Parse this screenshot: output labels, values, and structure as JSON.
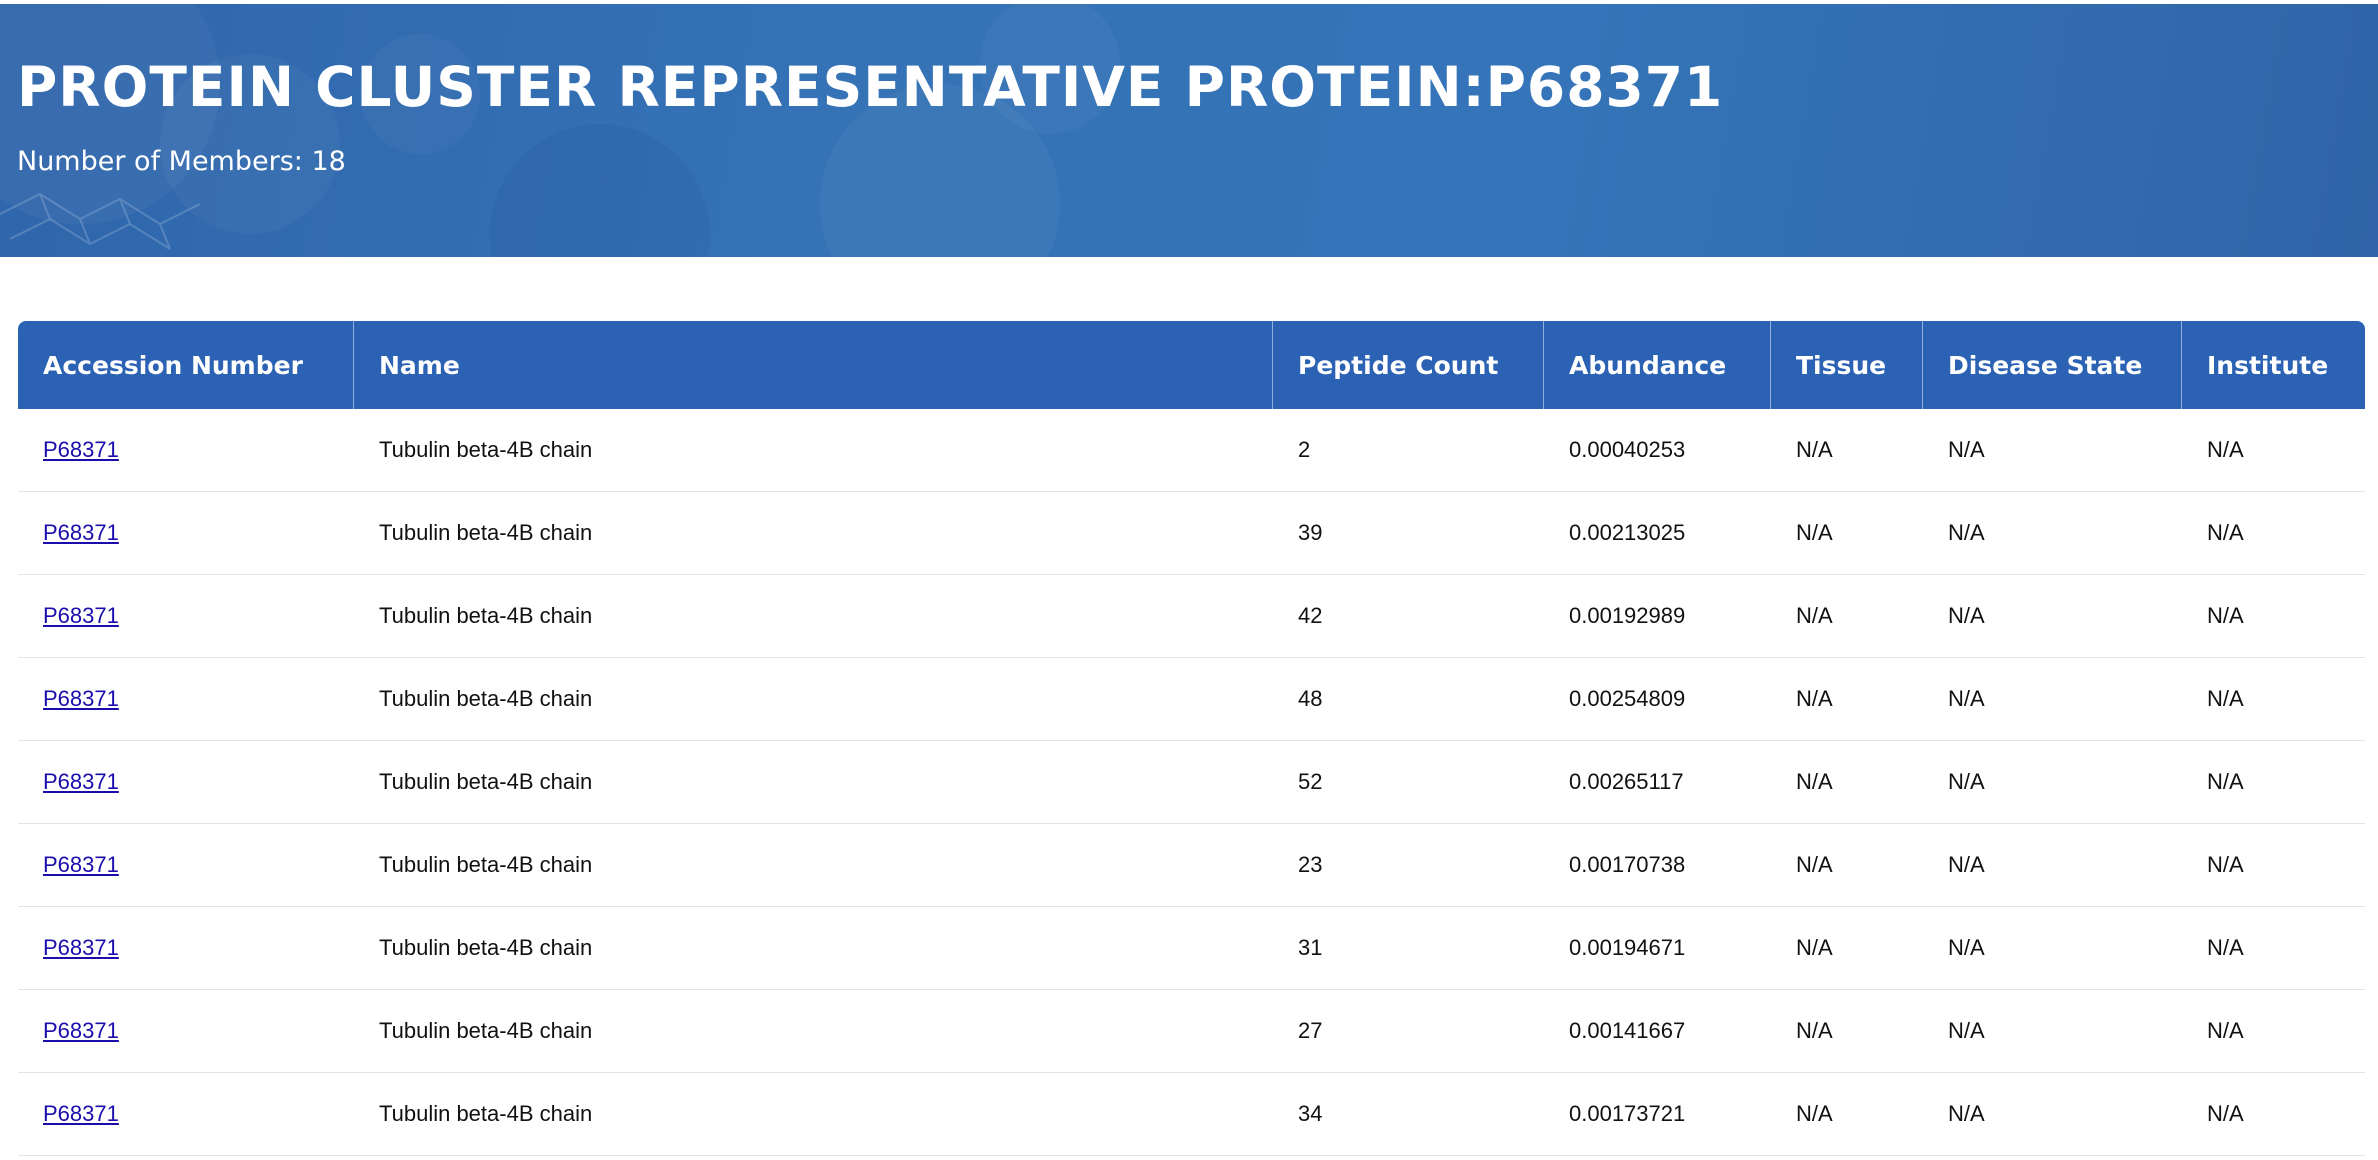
{
  "header": {
    "title": "PROTEIN CLUSTER REPRESENTATIVE PROTEIN:P68371",
    "members_label": "Number of Members: 18"
  },
  "table": {
    "columns": [
      "Accession Number",
      "Name",
      "Peptide Count",
      "Abundance",
      "Tissue",
      "Disease State",
      "Institute"
    ],
    "rows": [
      [
        "P68371",
        "Tubulin beta-4B chain",
        "2",
        "0.00040253",
        "N/A",
        "N/A",
        "N/A"
      ],
      [
        "P68371",
        "Tubulin beta-4B chain",
        "39",
        "0.00213025",
        "N/A",
        "N/A",
        "N/A"
      ],
      [
        "P68371",
        "Tubulin beta-4B chain",
        "42",
        "0.00192989",
        "N/A",
        "N/A",
        "N/A"
      ],
      [
        "P68371",
        "Tubulin beta-4B chain",
        "48",
        "0.00254809",
        "N/A",
        "N/A",
        "N/A"
      ],
      [
        "P68371",
        "Tubulin beta-4B chain",
        "52",
        "0.00265117",
        "N/A",
        "N/A",
        "N/A"
      ],
      [
        "P68371",
        "Tubulin beta-4B chain",
        "23",
        "0.00170738",
        "N/A",
        "N/A",
        "N/A"
      ],
      [
        "P68371",
        "Tubulin beta-4B chain",
        "31",
        "0.00194671",
        "N/A",
        "N/A",
        "N/A"
      ],
      [
        "P68371",
        "Tubulin beta-4B chain",
        "27",
        "0.00141667",
        "N/A",
        "N/A",
        "N/A"
      ],
      [
        "P68371",
        "Tubulin beta-4B chain",
        "34",
        "0.00173721",
        "N/A",
        "N/A",
        "N/A"
      ]
    ]
  },
  "colors": {
    "header_bg": "#3572b6",
    "table_header_bg": "#2c62b4",
    "link": "#1a0dab"
  }
}
